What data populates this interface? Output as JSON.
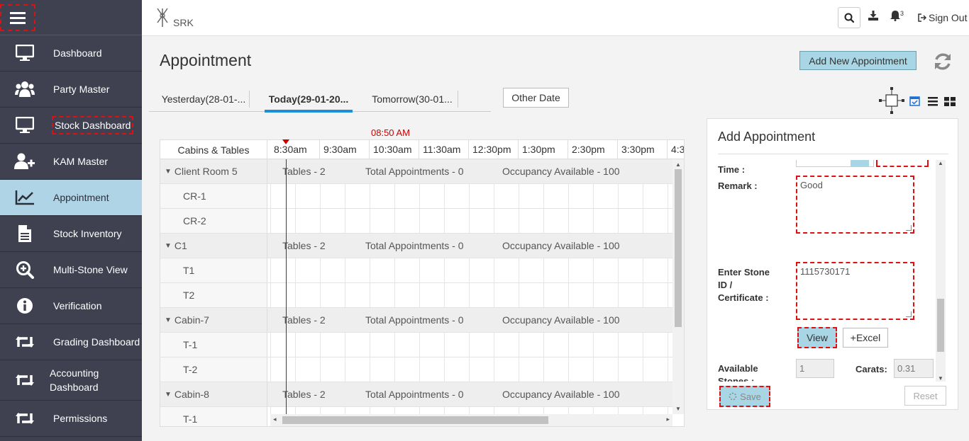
{
  "sidebar": {
    "items": [
      {
        "label": "Dashboard",
        "icon": "monitor-icon"
      },
      {
        "label": "Party Master",
        "icon": "users-icon"
      },
      {
        "label": "Stock Dashboard",
        "icon": "monitor-icon"
      },
      {
        "label": "KAM Master",
        "icon": "user-plus-icon"
      },
      {
        "label": "Appointment",
        "icon": "chart-line-icon"
      },
      {
        "label": "Stock Inventory",
        "icon": "document-icon"
      },
      {
        "label": "Multi-Stone View",
        "icon": "zoom-in-icon"
      },
      {
        "label": "Verification",
        "icon": "info-icon"
      },
      {
        "label": "Grading Dashboard",
        "icon": "retweet-icon"
      },
      {
        "label": "Accounting Dashboard",
        "icon": "retweet-icon"
      },
      {
        "label": "Permissions",
        "icon": "retweet-icon"
      }
    ]
  },
  "header": {
    "logo_text": "SRK",
    "notification_count": "3",
    "sign_out": "Sign Out"
  },
  "page": {
    "title": "Appointment",
    "add_button": "Add New Appointment"
  },
  "tabs": [
    {
      "label": "Yesterday(28-01-..."
    },
    {
      "label": "Today(29-01-20..."
    },
    {
      "label": "Tomorrow(30-01..."
    }
  ],
  "other_date": "Other Date",
  "scheduler": {
    "current_time": "08:50 AM",
    "column_header": "Cabins & Tables",
    "hours": [
      "8:30am",
      "9:30am",
      "10:30am",
      "11:30am",
      "12:30pm",
      "1:30pm",
      "2:30pm",
      "3:30pm",
      "4:3"
    ],
    "groups": [
      {
        "name": "Client Room 5",
        "tables": "Tables - 2",
        "total": "Total Appointments - 0",
        "occupancy": "Occupancy Available - 100",
        "rows": [
          "CR-1",
          "CR-2"
        ]
      },
      {
        "name": "C1",
        "tables": "Tables - 2",
        "total": "Total Appointments - 0",
        "occupancy": "Occupancy Available - 100",
        "rows": [
          "T1",
          "T2"
        ]
      },
      {
        "name": "Cabin-7",
        "tables": "Tables - 2",
        "total": "Total Appointments - 0",
        "occupancy": "Occupancy Available - 100",
        "rows": [
          "T-1",
          "T-2"
        ]
      },
      {
        "name": "Cabin-8",
        "tables": "Tables - 2",
        "total": "Total Appointments - 0",
        "occupancy": "Occupancy Available - 100",
        "rows": [
          "T-1"
        ]
      }
    ]
  },
  "form": {
    "title": "Add Appointment",
    "time_label": "Time :",
    "remark_label": "Remark :",
    "remark_value": "Good",
    "stone_label_1": "Enter Stone",
    "stone_label_2": "ID /",
    "stone_label_3": "Certificate :",
    "stone_value": "1115730171",
    "view_button": "View",
    "excel_button": "+Excel",
    "available_label_1": "Available",
    "available_label_2": "Stones :",
    "available_value": "1",
    "carats_label": "Carats:",
    "carats_value": "0.31",
    "save_button": "Save",
    "reset_button": "Reset"
  },
  "colors": {
    "sidebar_bg": "#3f4150",
    "accent": "#a9d6e5",
    "tab_active": "#1a8fd8",
    "time_marker": "#cc0000"
  }
}
